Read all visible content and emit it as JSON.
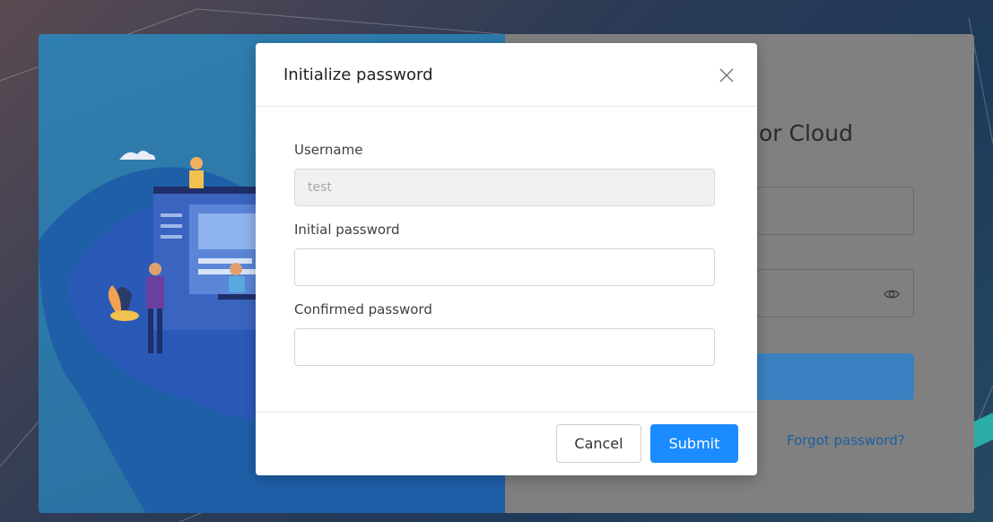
{
  "modal": {
    "title": "Initialize password",
    "fields": [
      {
        "label": "Username",
        "value": "test",
        "disabled": true
      },
      {
        "label": "Initial password",
        "value": ""
      },
      {
        "label": "Confirmed password",
        "value": ""
      }
    ],
    "cancel_label": "Cancel",
    "submit_label": "Submit"
  },
  "login": {
    "title_partial": "or Cloud",
    "forgot_label": "Forgot password?"
  },
  "colors": {
    "primary": "#1a8cff",
    "login_panel": "#2f7fb0"
  }
}
